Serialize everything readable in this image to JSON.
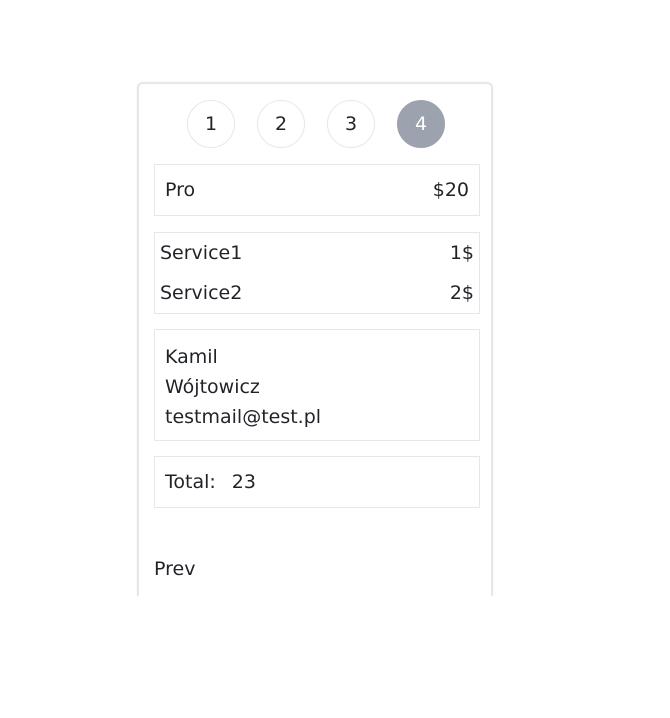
{
  "steps": [
    {
      "label": "1",
      "active": false
    },
    {
      "label": "2",
      "active": false
    },
    {
      "label": "3",
      "active": false
    },
    {
      "label": "4",
      "active": true
    }
  ],
  "plan": {
    "name": "Pro",
    "price": "$20"
  },
  "services": [
    {
      "name": "Service1",
      "price": "1$"
    },
    {
      "name": "Service2",
      "price": "2$"
    }
  ],
  "user": {
    "first_name": "Kamil",
    "last_name": "Wójtowicz",
    "email": "testmail@test.pl"
  },
  "total": {
    "label": "Total:",
    "value": "23"
  },
  "nav": {
    "prev_label": "Prev"
  },
  "colors": {
    "active_step": "#9ca3af",
    "border": "#e6e7ea"
  }
}
